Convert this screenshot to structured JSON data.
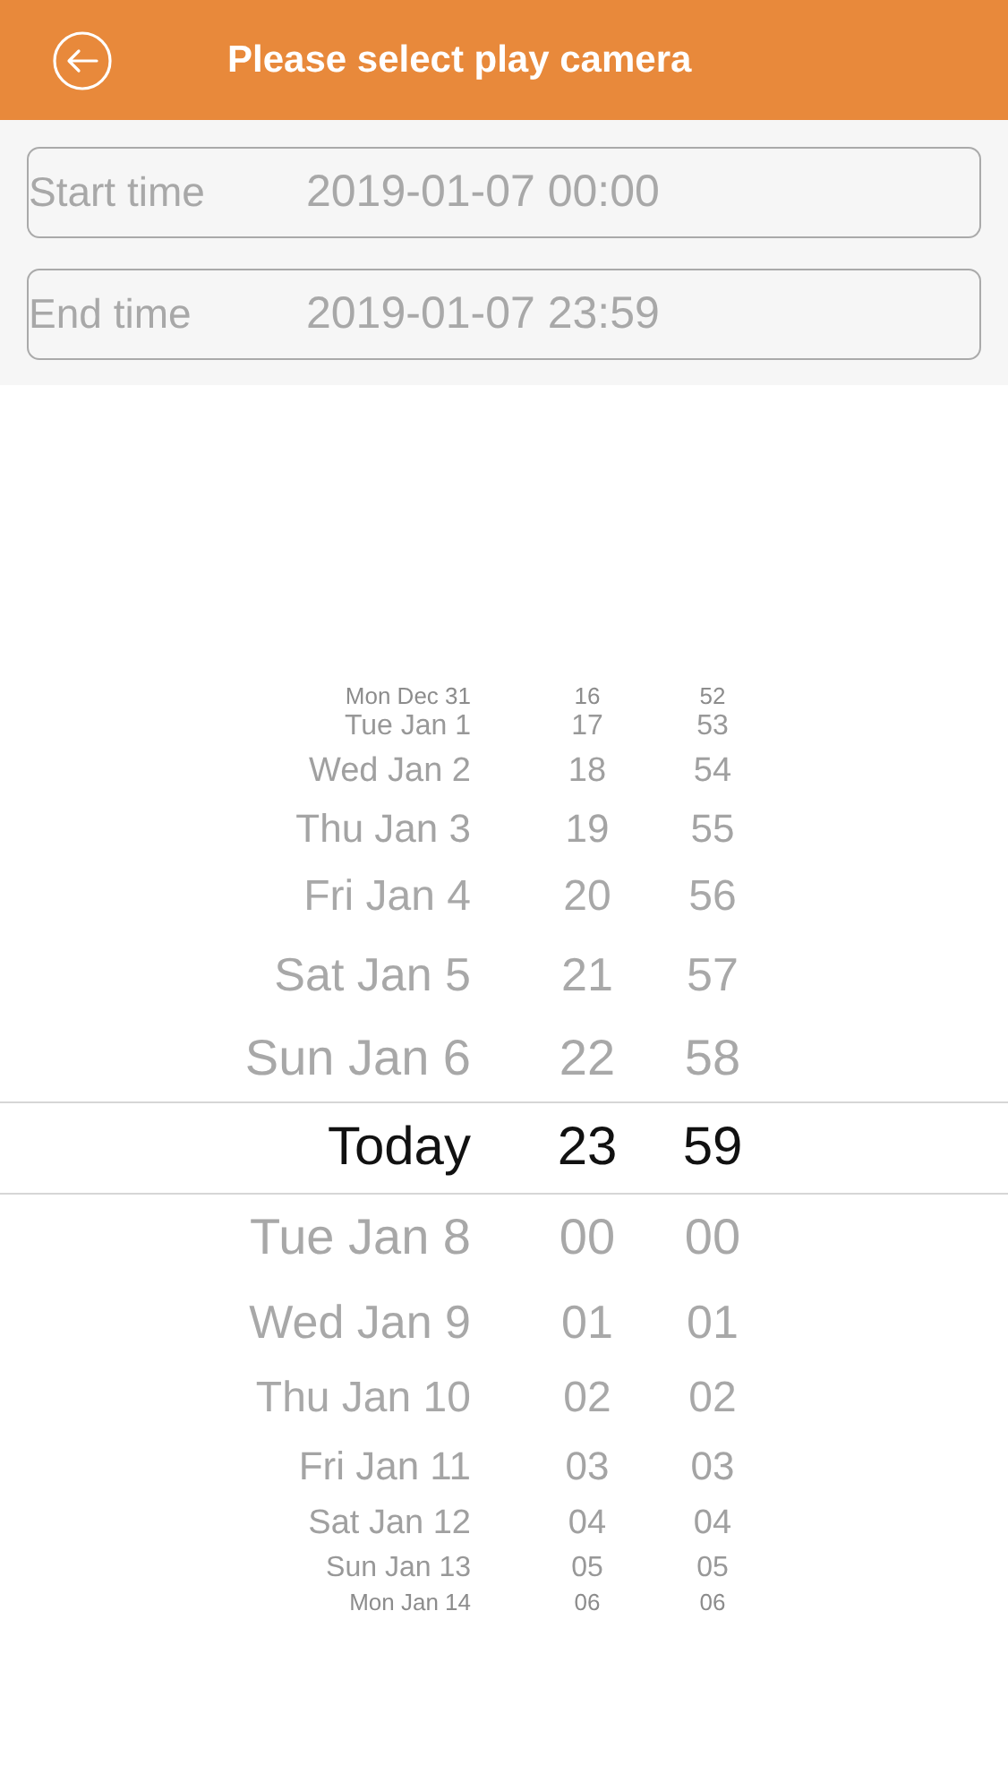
{
  "header": {
    "title": "Please select play camera"
  },
  "fields": [
    {
      "label": "Start time",
      "value": "2019-01-07 00:00"
    },
    {
      "label": "End time",
      "value": "2019-01-07 23:59"
    }
  ],
  "picker": {
    "rows": [
      {
        "day": "Mon Dec 31",
        "hour": "16",
        "minute": "52",
        "selected": false
      },
      {
        "day": "Tue Jan 1",
        "hour": "17",
        "minute": "53",
        "selected": false
      },
      {
        "day": "Wed Jan 2",
        "hour": "18",
        "minute": "54",
        "selected": false
      },
      {
        "day": "Thu Jan 3",
        "hour": "19",
        "minute": "55",
        "selected": false
      },
      {
        "day": "Fri Jan 4",
        "hour": "20",
        "minute": "56",
        "selected": false
      },
      {
        "day": "Sat Jan 5",
        "hour": "21",
        "minute": "57",
        "selected": false
      },
      {
        "day": "Sun Jan 6",
        "hour": "22",
        "minute": "58",
        "selected": false
      },
      {
        "day": "Today",
        "hour": "23",
        "minute": "59",
        "selected": true
      },
      {
        "day": "Tue Jan 8",
        "hour": "00",
        "minute": "00",
        "selected": false
      },
      {
        "day": "Wed Jan 9",
        "hour": "01",
        "minute": "01",
        "selected": false
      },
      {
        "day": "Thu Jan 10",
        "hour": "02",
        "minute": "02",
        "selected": false
      },
      {
        "day": "Fri Jan 11",
        "hour": "03",
        "minute": "03",
        "selected": false
      },
      {
        "day": "Sat Jan 12",
        "hour": "04",
        "minute": "04",
        "selected": false
      },
      {
        "day": "Sun Jan 13",
        "hour": "05",
        "minute": "05",
        "selected": false
      },
      {
        "day": "Mon Jan 14",
        "hour": "06",
        "minute": "06",
        "selected": false
      }
    ]
  }
}
